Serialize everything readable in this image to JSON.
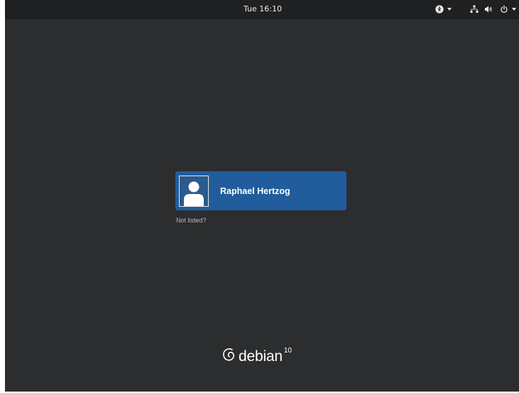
{
  "top_bar": {
    "clock": "Tue 16:10",
    "icons": {
      "accessibility": "accessibility-icon",
      "network": "network-wired-icon",
      "volume": "volume-icon",
      "power": "power-icon"
    }
  },
  "login": {
    "users": [
      {
        "name": "Raphael Hertzog",
        "avatar": "default-user-avatar-icon"
      }
    ],
    "not_listed_label": "Not listed?"
  },
  "branding": {
    "logo": "debian-swirl-icon",
    "name": "debian",
    "version": "10"
  },
  "colors": {
    "background": "#2b2d2e",
    "top_bar": "#1f2021",
    "user_selected": "#215d9c",
    "text": "#ffffff",
    "muted_text": "#babdb6"
  }
}
